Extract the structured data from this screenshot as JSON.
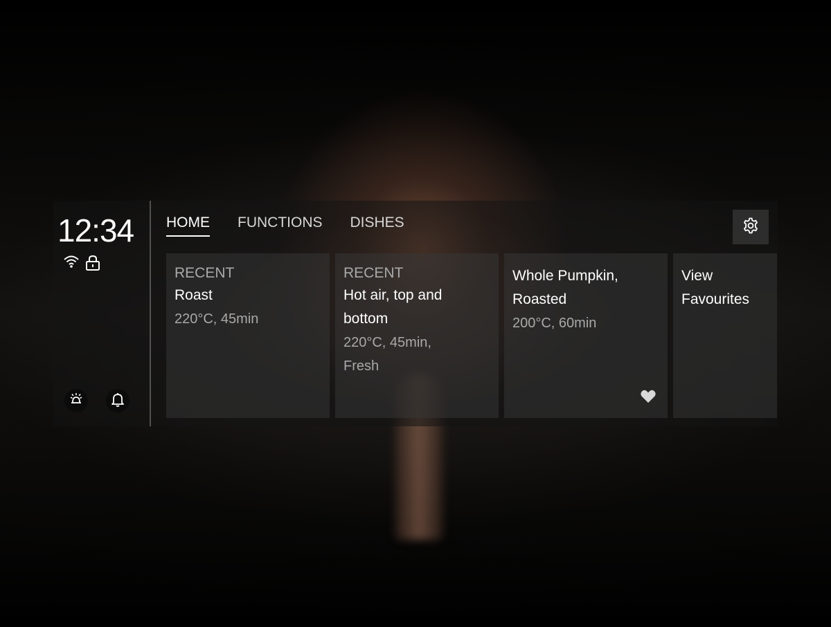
{
  "status": {
    "time": "12:34",
    "icons": [
      "wifi-icon",
      "lock-icon"
    ],
    "bottom_icons": [
      "oven-light-icon",
      "bell-icon"
    ]
  },
  "nav": {
    "tabs": [
      {
        "label": "HOME",
        "active": true
      },
      {
        "label": "FUNCTIONS",
        "active": false
      },
      {
        "label": "DISHES",
        "active": false
      }
    ],
    "settings_icon": "gear-icon"
  },
  "cards": [
    {
      "label": "RECENT",
      "title": "Roast",
      "meta": "220°C, 45min"
    },
    {
      "label": "RECENT",
      "title": "Hot air, top and bottom",
      "meta": "220°C, 45min, Fresh"
    },
    {
      "label": "",
      "title": "Whole Pumpkin, Roasted",
      "meta": "200°C, 60min",
      "favourite_icon": "heart-icon"
    },
    {
      "label": "",
      "title": "View Favourites",
      "meta": ""
    }
  ]
}
